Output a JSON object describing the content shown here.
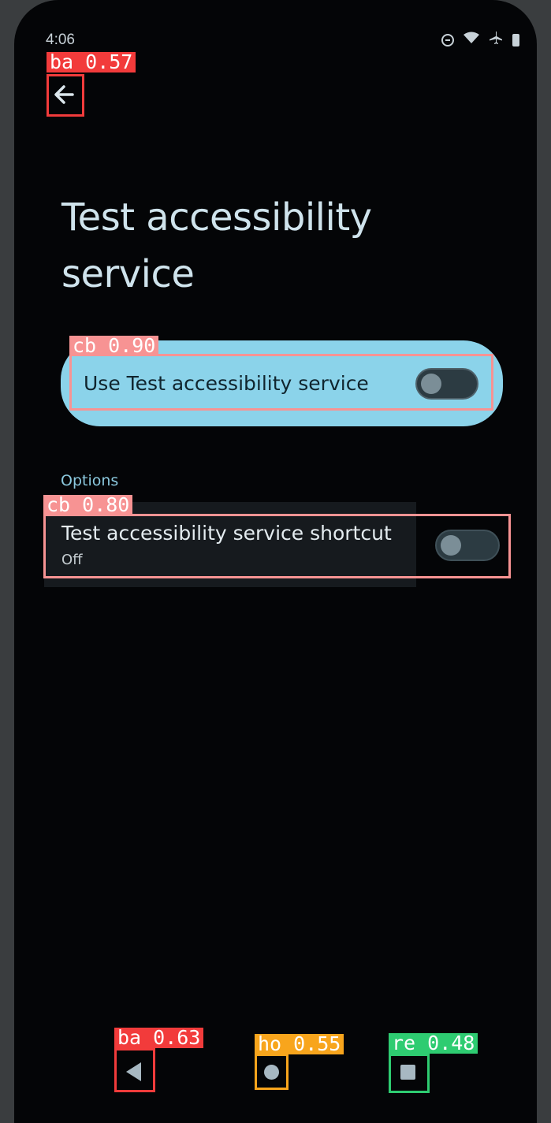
{
  "status_bar": {
    "time": "4:06",
    "icons": [
      "do-not-disturb-icon",
      "wifi-icon",
      "airplane-icon",
      "battery-icon"
    ]
  },
  "toolbar": {
    "back_icon": "arrow-left-icon"
  },
  "page": {
    "title_line1": "Test accessibility",
    "title_line2": "service"
  },
  "main_toggle": {
    "label": "Use Test accessibility service",
    "state": "off"
  },
  "options": {
    "header": "Options",
    "shortcut": {
      "title": "Test accessibility service shortcut",
      "status": "Off",
      "state": "off"
    }
  },
  "nav_bar": {
    "back_icon": "nav-back-icon",
    "home_icon": "nav-home-icon",
    "recents_icon": "nav-recents-icon"
  },
  "detections": [
    {
      "label": "ba 0.57",
      "color": "#f23b3b"
    },
    {
      "label": "cb 0.90",
      "color": "#f79393"
    },
    {
      "label": "cb 0.80",
      "color": "#f79393"
    },
    {
      "label": "ba 0.63",
      "color": "#f23b3b"
    },
    {
      "label": "ho 0.55",
      "color": "#f8a51c"
    },
    {
      "label": "re 0.48",
      "color": "#2ecc71"
    }
  ],
  "colors": {
    "background": "#040507",
    "accent_card": "#8bd3ea",
    "title_text": "#cfe3ec",
    "section_header": "#8bc8dd"
  }
}
